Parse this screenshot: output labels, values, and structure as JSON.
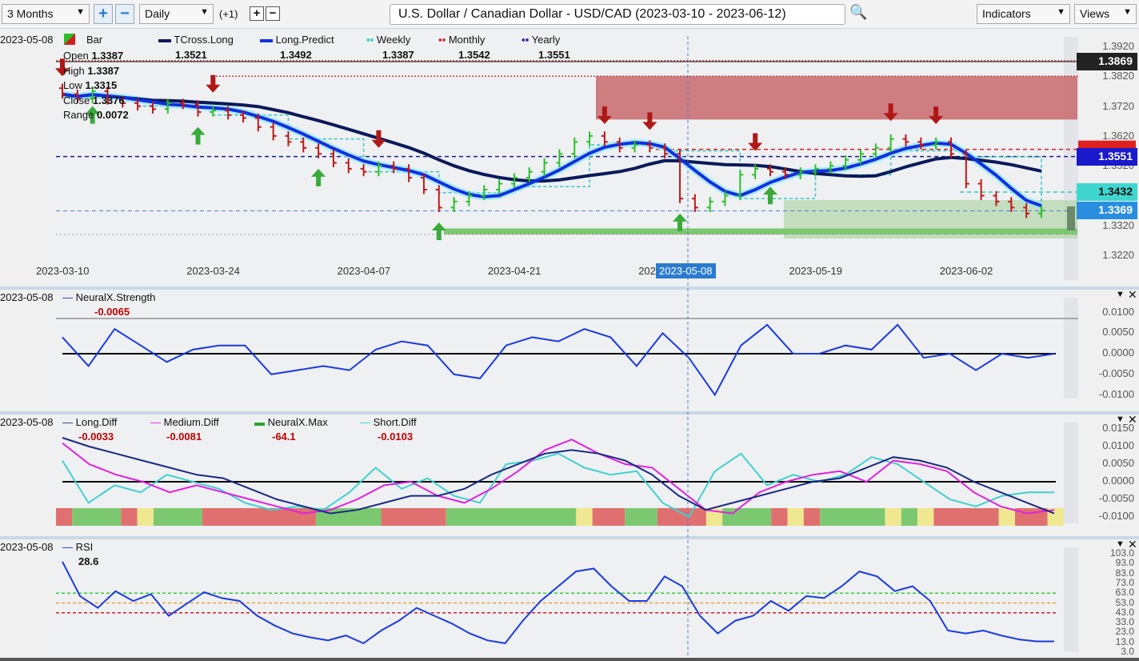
{
  "toolbar": {
    "range": "3 Months",
    "interval": "Daily",
    "offset": "(+1)",
    "title": "U.S. Dollar / Canadian Dollar - USD/CAD (2023-03-10 - 2023-06-12)",
    "indicators": "Indicators",
    "views": "Views"
  },
  "cursor_date": "2023-05-08",
  "main": {
    "legend": [
      {
        "name": "Bar",
        "value": ""
      },
      {
        "name": "TCross.Long",
        "value": "1.3521"
      },
      {
        "name": "Long.Predict",
        "value": "1.3492"
      },
      {
        "name": "Weekly",
        "value": "1.3387"
      },
      {
        "name": "Monthly",
        "value": "1.3542"
      },
      {
        "name": "Yearly",
        "value": "1.3551"
      }
    ],
    "ohlc": {
      "open_label": "Open",
      "open": "1.3387",
      "high_label": "High",
      "high": "1.3387",
      "low_label": "Low",
      "low": "1.3315",
      "close_label": "Close",
      "close": "1.3376",
      "range_label": "Range",
      "range": "0.0072"
    },
    "y_ticks": [
      "1.3920",
      "1.3820",
      "1.3720",
      "1.3620",
      "1.3520",
      "1.3420",
      "1.3320",
      "1.3220"
    ],
    "price_tags": [
      {
        "value": "1.3869",
        "color": "#222222"
      },
      {
        "value": "1.3551",
        "color": "#1a1acc"
      },
      {
        "value": "1.3432",
        "color": "#3fd6cf"
      },
      {
        "value": "1.3369",
        "color": "#2a8ee0"
      }
    ],
    "x_ticks": [
      "2023-03-10",
      "2023-03-24",
      "2023-04-07",
      "2023-04-21",
      "2023-05-05",
      "2023-05-19",
      "2023-06-02"
    ],
    "closes": [
      1.376,
      1.3745,
      1.377,
      1.374,
      1.373,
      1.372,
      1.371,
      1.373,
      1.3725,
      1.37,
      1.3705,
      1.369,
      1.368,
      1.365,
      1.362,
      1.36,
      1.358,
      1.356,
      1.353,
      1.351,
      1.35,
      1.352,
      1.351,
      1.348,
      1.344,
      1.338,
      1.34,
      1.342,
      1.344,
      1.346,
      1.348,
      1.35,
      1.353,
      1.356,
      1.36,
      1.362,
      1.36,
      1.358,
      1.359,
      1.358,
      1.356,
      1.341,
      1.338,
      1.34,
      1.342,
      1.349,
      1.351,
      1.35,
      1.349,
      1.35,
      1.351,
      1.352,
      1.354,
      1.356,
      1.358,
      1.361,
      1.36,
      1.359,
      1.36,
      1.356,
      1.346,
      1.342,
      1.34,
      1.338,
      1.336,
      1.337
    ],
    "signals_down": [
      0,
      10,
      21,
      36,
      39,
      46,
      55,
      58
    ],
    "signals_up": [
      2,
      9,
      17,
      25,
      41,
      47
    ],
    "levels": {
      "top": 1.3869,
      "resistance_zone": [
        1.3675,
        1.382
      ],
      "monthly": 1.3575,
      "yearly": 1.3551,
      "weekly": 1.3432,
      "blue": 1.3369,
      "support_zone": [
        1.329,
        1.331
      ]
    }
  },
  "strength": {
    "legend": "NeuralX.Strength",
    "value": "-0.0065",
    "y_ticks": [
      "0.0100",
      "0.0050",
      "0.0000",
      "-0.0050",
      "-0.0100"
    ],
    "values": [
      0.004,
      -0.003,
      0.006,
      0.002,
      -0.002,
      0.001,
      0.002,
      0.002,
      -0.005,
      -0.004,
      -0.003,
      -0.004,
      0.001,
      0.003,
      0.002,
      -0.005,
      -0.006,
      0.002,
      0.004,
      0.003,
      0.006,
      0.004,
      -0.003,
      0.005,
      -0.001,
      -0.01,
      0.002,
      0.007,
      0.0,
      0.0,
      0.002,
      0.001,
      0.007,
      -0.001,
      0.0,
      -0.004,
      0.0,
      -0.001,
      0.0
    ]
  },
  "diff": {
    "legend": [
      {
        "name": "Long.Diff",
        "value": "-0.0033",
        "color": "#1a2a80"
      },
      {
        "name": "Medium.Diff",
        "value": "-0.0081",
        "color": "#e020e0"
      },
      {
        "name": "NeuralX.Max",
        "value": "-64.1",
        "color": "#2aa02a"
      },
      {
        "name": "Short.Diff",
        "value": "-0.0103",
        "color": "#40d0d0"
      }
    ],
    "y_ticks": [
      "0.0150",
      "0.0100",
      "0.0050",
      "0.0000",
      "-0.0050",
      "-0.0100"
    ],
    "long": [
      0.0125,
      0.01,
      0.008,
      0.006,
      0.004,
      0.002,
      0.001,
      -0.002,
      -0.005,
      -0.007,
      -0.009,
      -0.008,
      -0.006,
      -0.004,
      -0.004,
      -0.002,
      0.002,
      0.005,
      0.008,
      0.009,
      0.008,
      0.006,
      0.002,
      -0.004,
      -0.008,
      -0.006,
      -0.004,
      -0.002,
      0.0,
      0.001,
      0.004,
      0.007,
      0.006,
      0.004,
      0.0,
      -0.003,
      -0.006,
      -0.009
    ],
    "medium": [
      0.011,
      0.005,
      0.002,
      0.0,
      -0.003,
      -0.001,
      -0.003,
      -0.005,
      -0.007,
      -0.009,
      -0.008,
      -0.005,
      -0.001,
      0.0,
      -0.004,
      -0.006,
      -0.002,
      0.003,
      0.009,
      0.012,
      0.008,
      0.005,
      0.004,
      -0.002,
      -0.008,
      -0.009,
      -0.003,
      0.0,
      0.002,
      0.003,
      0.0,
      0.006,
      0.005,
      0.003,
      -0.003,
      -0.007,
      -0.009,
      -0.008
    ],
    "short": [
      0.006,
      -0.006,
      -0.001,
      -0.003,
      0.002,
      0.0,
      -0.002,
      -0.006,
      -0.008,
      -0.007,
      -0.008,
      -0.003,
      0.004,
      -0.002,
      0.001,
      -0.004,
      -0.006,
      0.005,
      0.006,
      0.008,
      0.004,
      0.002,
      0.003,
      -0.006,
      -0.01,
      0.003,
      0.008,
      -0.001,
      0.002,
      0.0,
      0.002,
      0.007,
      0.005,
      0.0,
      -0.005,
      -0.007,
      -0.004,
      -0.003,
      -0.003
    ],
    "strip": [
      [
        "r",
        1
      ],
      [
        "g",
        3
      ],
      [
        "r",
        1
      ],
      [
        "y",
        1
      ],
      [
        "g",
        3
      ],
      [
        "r",
        7
      ],
      [
        "g",
        4
      ],
      [
        "r",
        4
      ],
      [
        "g",
        8
      ],
      [
        "y",
        1
      ],
      [
        "r",
        2
      ],
      [
        "g",
        2
      ],
      [
        "r",
        3
      ],
      [
        "y",
        1
      ],
      [
        "g",
        3
      ],
      [
        "r",
        1
      ],
      [
        "y",
        1
      ],
      [
        "r",
        1
      ],
      [
        "g",
        4
      ],
      [
        "y",
        1
      ],
      [
        "g",
        1
      ],
      [
        "y",
        1
      ],
      [
        "r",
        4
      ],
      [
        "y",
        1
      ],
      [
        "r",
        2
      ],
      [
        "y",
        1
      ]
    ]
  },
  "rsi": {
    "legend": "RSI",
    "value": "28.6",
    "y_ticks": [
      "103.0",
      "93.0",
      "83.0",
      "73.0",
      "63.0",
      "53.0",
      "43.0",
      "33.0",
      "23.0",
      "13.0",
      "3.0"
    ],
    "values": [
      95,
      60,
      48,
      65,
      55,
      62,
      40,
      52,
      64,
      58,
      55,
      40,
      30,
      22,
      18,
      15,
      20,
      12,
      25,
      35,
      48,
      40,
      32,
      22,
      15,
      12,
      35,
      55,
      70,
      85,
      88,
      70,
      55,
      55,
      80,
      70,
      40,
      22,
      35,
      40,
      55,
      45,
      60,
      58,
      70,
      85,
      80,
      65,
      70,
      55,
      25,
      22,
      25,
      20,
      16,
      14,
      14
    ],
    "levels": [
      63,
      53,
      43
    ]
  }
}
